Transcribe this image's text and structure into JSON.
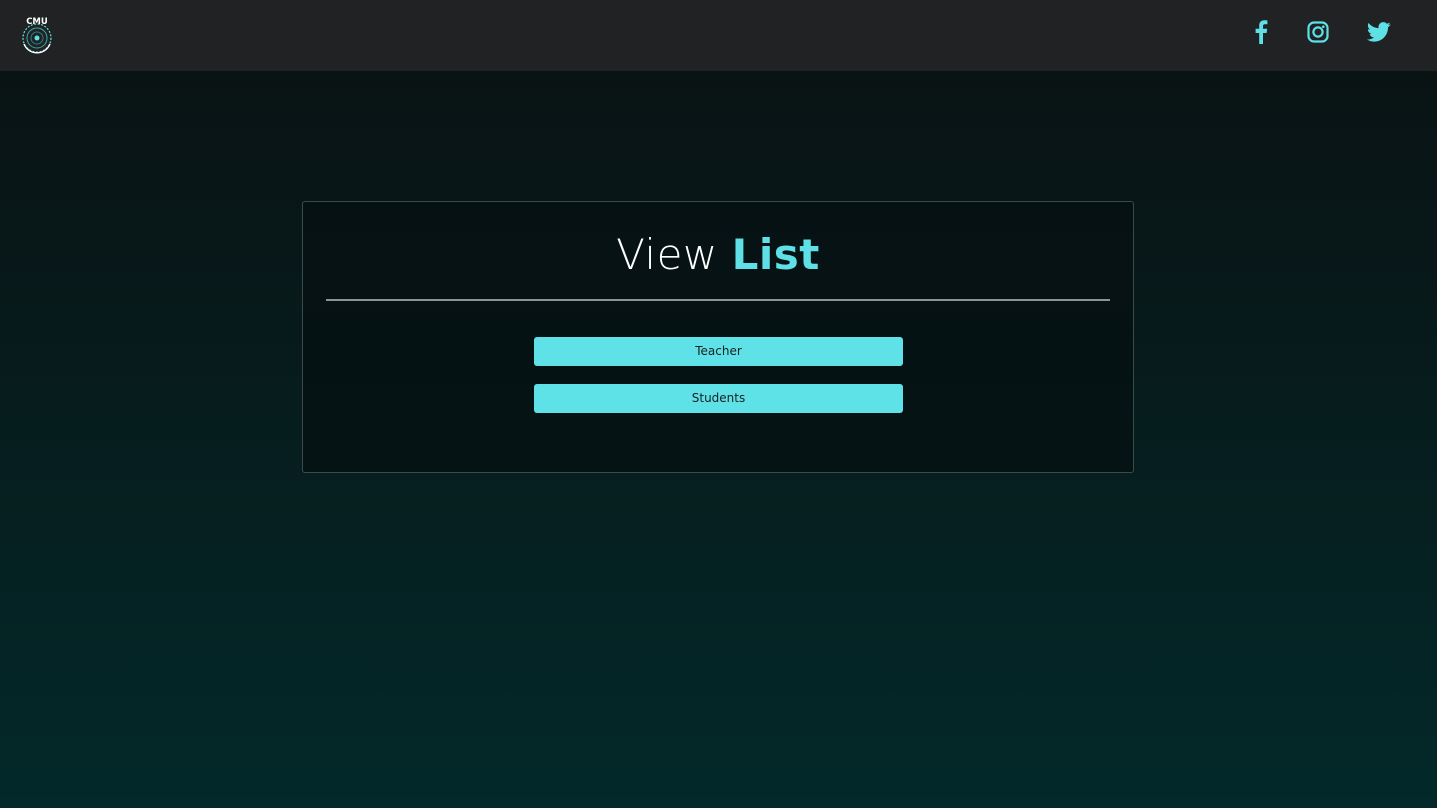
{
  "header": {
    "logo": {
      "text": "CMU",
      "icon": "cmu-logo-icon"
    },
    "social": [
      {
        "name": "facebook",
        "icon": "facebook-icon"
      },
      {
        "name": "instagram",
        "icon": "instagram-icon"
      },
      {
        "name": "twitter",
        "icon": "twitter-icon"
      }
    ]
  },
  "card": {
    "title_prefix": "View",
    "title_accent": "List",
    "buttons": {
      "teacher_label": "Teacher",
      "students_label": "Students"
    }
  },
  "colors": {
    "accent": "#5ee0e6",
    "navbar": "#202223",
    "background_top": "#0a1112",
    "background_bottom": "#03292a"
  }
}
